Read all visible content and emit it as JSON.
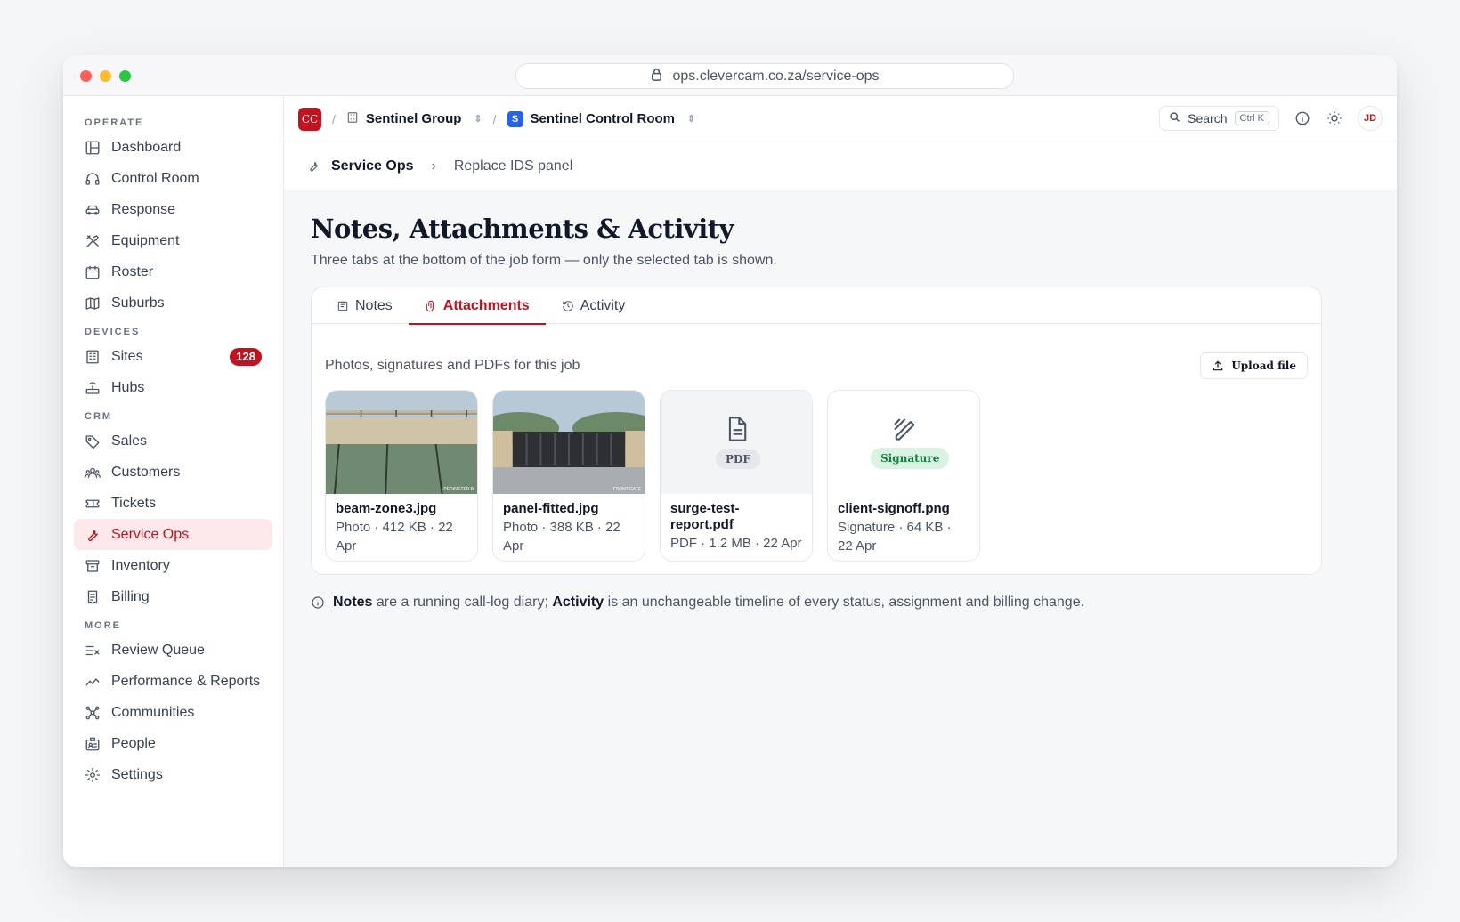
{
  "browser": {
    "url": "ops.clevercam.co.za/service-ops"
  },
  "sidebar": {
    "sections": [
      {
        "label": "OPERATE",
        "items": [
          {
            "label": "Dashboard",
            "icon": "dashboard-icon"
          },
          {
            "label": "Control Room",
            "icon": "headset-icon"
          },
          {
            "label": "Response",
            "icon": "car-icon"
          },
          {
            "label": "Equipment",
            "icon": "tools-icon"
          },
          {
            "label": "Roster",
            "icon": "calendar-icon"
          },
          {
            "label": "Suburbs",
            "icon": "map-icon"
          }
        ]
      },
      {
        "label": "DEVICES",
        "items": [
          {
            "label": "Sites",
            "icon": "building-icon",
            "badge": "128"
          },
          {
            "label": "Hubs",
            "icon": "router-icon"
          }
        ]
      },
      {
        "label": "CRM",
        "items": [
          {
            "label": "Sales",
            "icon": "tag-icon"
          },
          {
            "label": "Customers",
            "icon": "users-icon"
          },
          {
            "label": "Tickets",
            "icon": "ticket-icon"
          },
          {
            "label": "Service Ops",
            "icon": "wrench-icon",
            "active": true
          },
          {
            "label": "Inventory",
            "icon": "archive-icon"
          },
          {
            "label": "Billing",
            "icon": "receipt-icon"
          }
        ]
      },
      {
        "label": "MORE",
        "items": [
          {
            "label": "Review Queue",
            "icon": "list-check-icon"
          },
          {
            "label": "Performance & Reports",
            "icon": "trend-icon"
          },
          {
            "label": "Communities",
            "icon": "network-icon"
          },
          {
            "label": "People",
            "icon": "id-card-icon"
          },
          {
            "label": "Settings",
            "icon": "gear-icon"
          }
        ]
      }
    ]
  },
  "topbar": {
    "logo_text": "CC",
    "org_name": "Sentinel Group",
    "room_badge": "S",
    "room_name": "Sentinel Control Room",
    "search_label": "Search",
    "search_shortcut": "Ctrl K",
    "avatar_initials": "JD"
  },
  "breadcrumb": {
    "section": "Service Ops",
    "current": "Replace IDS panel"
  },
  "page": {
    "title": "Notes, Attachments & Activity",
    "subtitle": "Three tabs at the bottom of the job form — only the selected tab is shown."
  },
  "tabs": [
    {
      "label": "Notes",
      "icon": "note-icon"
    },
    {
      "label": "Attachments",
      "icon": "paperclip-icon",
      "active": true
    },
    {
      "label": "Activity",
      "icon": "history-icon"
    }
  ],
  "attachments": {
    "caption": "Photos, signatures and PDFs for this job",
    "upload_label": "Upload file",
    "files": [
      {
        "name": "beam-zone3.jpg",
        "meta": "Photo · 412 KB · 22 Apr",
        "kind": "photo",
        "watermark": "PERIMETER B"
      },
      {
        "name": "panel-fitted.jpg",
        "meta": "Photo · 388 KB · 22 Apr",
        "kind": "photo",
        "watermark": "FRONT GATE"
      },
      {
        "name": "surge-test-report.pdf",
        "meta": "PDF · 1.2 MB · 22 Apr",
        "kind": "pdf",
        "tag": "PDF"
      },
      {
        "name": "client-signoff.png",
        "meta": "Signature · 64 KB · 22 Apr",
        "kind": "signature",
        "tag": "Signature"
      }
    ]
  },
  "footnote": {
    "notes_word": "Notes",
    "part1": " are a running call-log diary; ",
    "activity_word": "Activity",
    "part2": " is an unchangeable timeline of every status, assignment and billing change."
  },
  "colors": {
    "accent": "#c1121f",
    "accent_bg": "#fde8ea",
    "signature_bg": "#d9f2e2",
    "signature_text": "#16803c"
  }
}
